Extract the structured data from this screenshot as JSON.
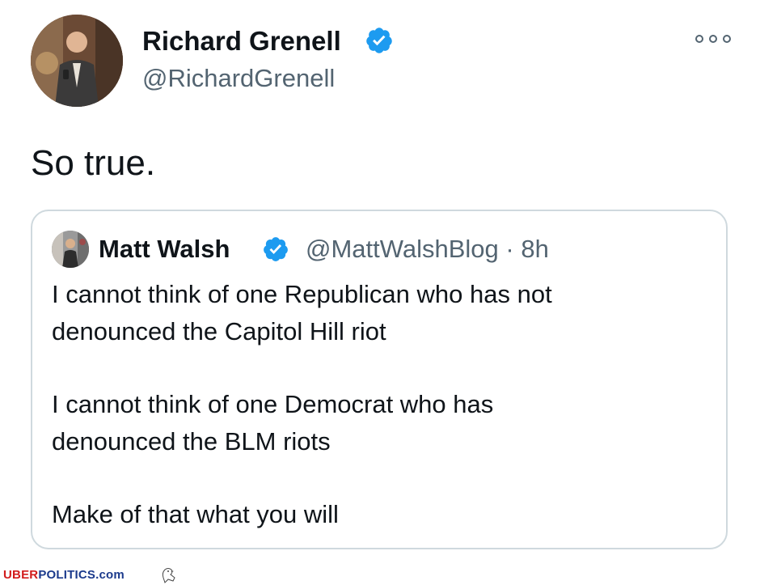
{
  "tweet": {
    "author_name": "Richard Grenell",
    "author_handle": "@RichardGrenell",
    "text": "So true.",
    "verified_icon": "verified-badge-icon",
    "more_icon": "more-options-icon"
  },
  "quote": {
    "author_name": "Matt Walsh",
    "meta": "@MattWalshBlog · 8h",
    "lines": [
      "I cannot think of one Republican who has not",
      "denounced the Capitol Hill riot",
      "I cannot think of one Democrat who has",
      "denounced the BLM riots",
      "Make of that what you will"
    ]
  },
  "watermark": {
    "part1": "UBER",
    "part2": "POLITICS",
    "part3": ".com"
  },
  "colors": {
    "verified": "#1d9bf0",
    "secondary_text": "#536471",
    "card_border": "#cfd9de",
    "watermark_red": "#d21c1c",
    "watermark_blue": "#1b3a8c"
  }
}
